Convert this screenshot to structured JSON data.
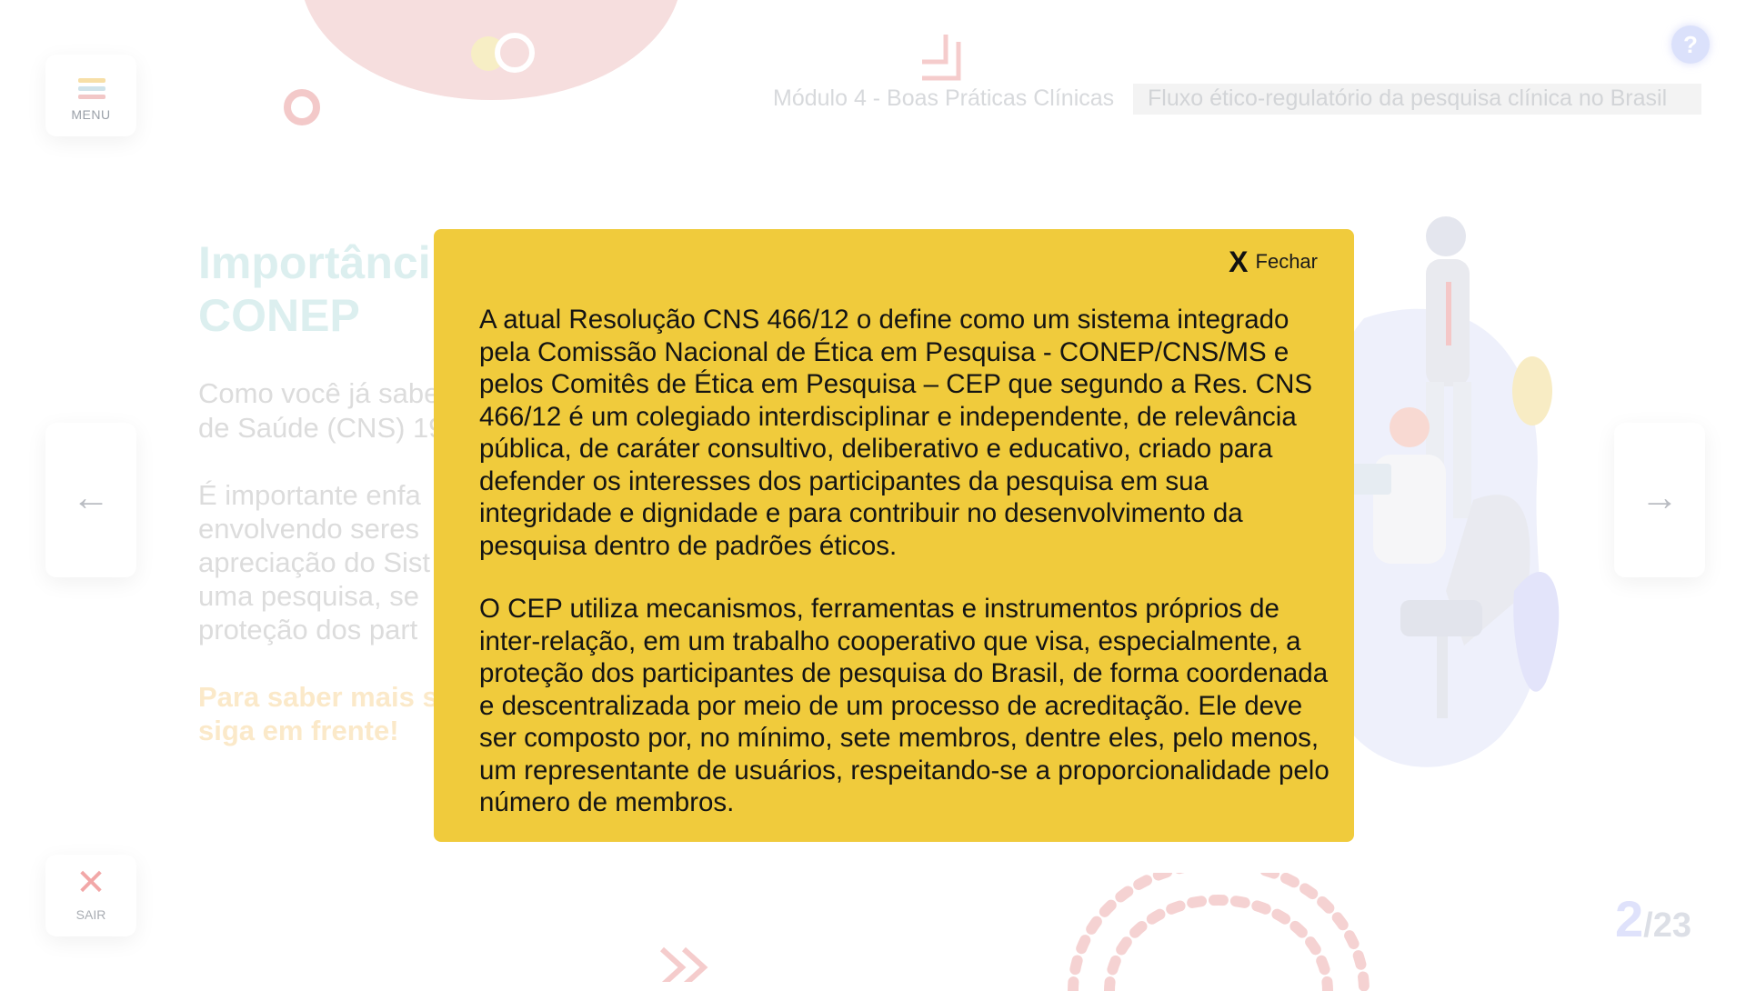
{
  "menu": {
    "label": "MENU",
    "line_colors": [
      "#f7dfa7",
      "#cfe3ea",
      "#f2c7c7"
    ]
  },
  "exit": {
    "label": "SAIR",
    "icon": "close-x-icon"
  },
  "header": {
    "module": "Módulo 4 - Boas Práticas Clínicas",
    "topic": "Fluxo ético-regulatório da pesquisa clínica no Brasil",
    "help": "?"
  },
  "content": {
    "title": "Importânci\nCONEP",
    "p1": "Como você já sabe\nde Saúde (CNS) 19",
    "p2": "É importante enfa\nenvolvendo seres\napreciação do Sist\numa pesquisa, se\nproteção dos part",
    "cta": "Para saber mais s\nsiga em frente!"
  },
  "nav": {
    "prev_icon": "←",
    "next_icon": "→"
  },
  "pagination": {
    "current": "2",
    "total": "/23"
  },
  "modal": {
    "close_icon": "X",
    "close_label": "Fechar",
    "paragraph1": "A atual Resolução CNS 466/12 o define como um sistema integrado pela Comissão Nacional de Ética em Pesquisa - CONEP/CNS/MS e pelos Comitês de Ética em Pesquisa – CEP que segundo a Res. CNS 466/12 é um colegiado interdisciplinar e independente, de relevância pública, de caráter consultivo, deliberativo e educativo, criado para defender os interesses dos participantes da pesquisa em sua integridade e dignidade e para contribuir no desenvolvimento da pesquisa dentro de padrões éticos.",
    "paragraph2": "O CEP utiliza mecanismos, ferramentas e instrumentos próprios de inter-relação, em um trabalho cooperativo que visa, especialmente, a proteção dos participantes de pesquisa do Brasil, de forma coordenada e descentralizada por meio de um processo de acreditação. Ele deve ser  composto por, no mínimo, sete membros, dentre eles, pelo menos, um representante de usuários, respeitando-se a proporcionalidade pelo número de membros."
  },
  "colors": {
    "modal_bg": "#f0cb3c",
    "accent_pink": "#f2a7a7",
    "accent_blue": "#dbe1fb"
  }
}
